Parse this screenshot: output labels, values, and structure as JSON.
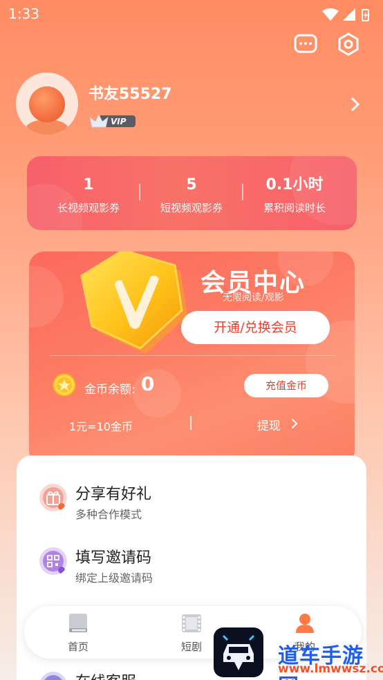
{
  "status_bar": {
    "time": "1:33"
  },
  "profile": {
    "username": "书友55527",
    "badge": "VIP"
  },
  "stats": [
    {
      "value": "1",
      "label": "长视频观影券"
    },
    {
      "value": "5",
      "label": "短视频观影券"
    },
    {
      "value": "0.1小时",
      "label": "累积阅读时长"
    }
  ],
  "member": {
    "title": "会员中心",
    "subtitle": "无限阅读/观影",
    "open_button": "开通/兑换会员",
    "coin_label": "金币余额:",
    "coin_value": "0",
    "recharge_button": "充值金币",
    "rate": "1元=10金币",
    "withdraw": "提现"
  },
  "menu": [
    {
      "title": "分享有好礼",
      "subtitle": "多种合作模式",
      "icon": "gift-icon"
    },
    {
      "title": "填写邀请码",
      "subtitle": "绑定上级邀请码",
      "icon": "qr-code-icon"
    },
    {
      "title": "在线客服",
      "icon": "customer-service-icon"
    }
  ],
  "nav": [
    {
      "label": "首页",
      "icon": "book-icon"
    },
    {
      "label": "短剧",
      "icon": "film-icon"
    },
    {
      "label": "我的",
      "icon": "person-icon"
    }
  ],
  "watermark": {
    "title": "道车手游网",
    "url": "www.lmwwsz.com"
  },
  "colors": {
    "accent": "#ff8a60",
    "card": "#f7606a",
    "button_text": "#e8412b"
  }
}
